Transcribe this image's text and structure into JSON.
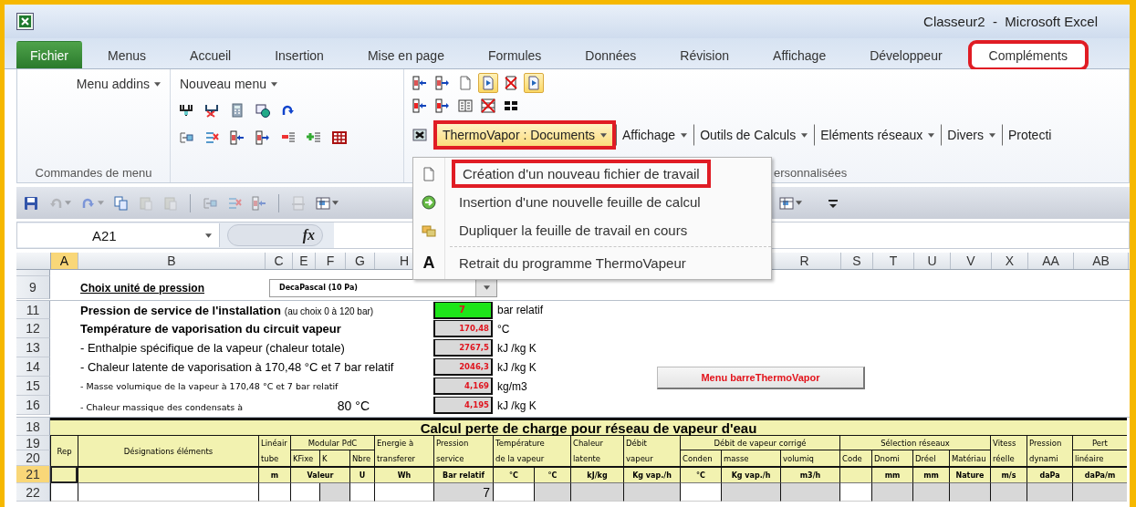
{
  "window": {
    "title": "Classeur2  -  Microsoft Excel"
  },
  "tabs": [
    {
      "label": "Fichier",
      "kind": "file",
      "selected": false,
      "highlighted": false
    },
    {
      "label": "Menus",
      "kind": "tab",
      "selected": false,
      "highlighted": false
    },
    {
      "label": "Accueil",
      "kind": "tab",
      "selected": false,
      "highlighted": false
    },
    {
      "label": "Insertion",
      "kind": "tab",
      "selected": false,
      "highlighted": false
    },
    {
      "label": "Mise en page",
      "kind": "tab",
      "selected": false,
      "highlighted": false
    },
    {
      "label": "Formules",
      "kind": "tab",
      "selected": false,
      "highlighted": false
    },
    {
      "label": "Données",
      "kind": "tab",
      "selected": false,
      "highlighted": false
    },
    {
      "label": "Révision",
      "kind": "tab",
      "selected": false,
      "highlighted": false
    },
    {
      "label": "Affichage",
      "kind": "tab",
      "selected": false,
      "highlighted": false
    },
    {
      "label": "Développeur",
      "kind": "tab",
      "selected": false,
      "highlighted": false
    },
    {
      "label": "Compléments",
      "kind": "tab",
      "selected": true,
      "highlighted": true
    }
  ],
  "ribbon": {
    "menu_group": {
      "menu": "Menu addins",
      "label": "Commandes de menu"
    },
    "new_menu_group": {
      "menu": "Nouveau menu",
      "icon_rows": [
        [
          {
            "kind": "fork",
            "pressed": false
          },
          {
            "kind": "fork-x",
            "pressed": false
          },
          {
            "kind": "calc",
            "pressed": false
          },
          {
            "kind": "globe",
            "pressed": false
          },
          {
            "kind": "redo",
            "pressed": false
          }
        ],
        [
          {
            "kind": "list-arrow",
            "pressed": false
          },
          {
            "kind": "list-x",
            "pressed": false
          },
          {
            "kind": "column-in",
            "pressed": false
          },
          {
            "kind": "column-out",
            "pressed": false
          },
          {
            "kind": "list-minus",
            "pressed": false
          },
          {
            "kind": "list-plus",
            "pressed": false
          },
          {
            "kind": "table",
            "pressed": false
          }
        ]
      ]
    },
    "toolbars_group": {
      "label": "ersonnalisées",
      "icon_rows": [
        [
          {
            "kind": "column-in",
            "pressed": false
          },
          {
            "kind": "column-out",
            "pressed": false
          },
          {
            "kind": "page",
            "pressed": false
          },
          {
            "kind": "doc-blue",
            "pressed": true
          },
          {
            "kind": "page-x",
            "pressed": false
          },
          {
            "kind": "doc-blue",
            "pressed": true
          }
        ],
        [
          {
            "kind": "column-in-red",
            "pressed": false
          },
          {
            "kind": "column-out-red",
            "pressed": false
          },
          {
            "kind": "book",
            "pressed": false
          },
          {
            "kind": "grid-x",
            "pressed": false
          },
          {
            "kind": "tiles",
            "pressed": false
          }
        ]
      ],
      "row_icon": {
        "kind": "image-x",
        "pressed": false
      },
      "menubar": [
        {
          "label": "ThermoVapor : Documents",
          "caret": true,
          "open": true,
          "highlighted": true
        },
        {
          "label": "Affichage",
          "caret": true,
          "open": false,
          "highlighted": false
        },
        {
          "label": "Outils de Calculs",
          "caret": true,
          "open": false,
          "highlighted": false
        },
        {
          "label": "Eléments réseaux",
          "caret": true,
          "open": false,
          "highlighted": false
        },
        {
          "label": "Divers",
          "caret": true,
          "open": false,
          "highlighted": false
        },
        {
          "label": "Protecti",
          "caret": false,
          "open": false,
          "highlighted": false
        }
      ]
    }
  },
  "dropdown": {
    "groups": [
      [
        {
          "kind": "page",
          "label": "Création d'un nouveau fichier de travail",
          "highlighted": true
        },
        {
          "kind": "circle-arrow",
          "label": "Insertion d'une nouvelle feuille de calcul",
          "highlighted": false
        },
        {
          "kind": "folders",
          "label": "Dupliquer la feuille de travail en cours",
          "highlighted": false
        }
      ],
      [
        {
          "kind": "letter",
          "glyph": "A",
          "label": "Retrait du programme ThermoVapeur",
          "highlighted": false
        }
      ]
    ]
  },
  "quick_access": {
    "left": [
      [
        {
          "kind": "save",
          "disabled": false,
          "caret": false
        },
        {
          "kind": "undo",
          "disabled": true,
          "caret": true
        },
        {
          "kind": "redo",
          "disabled": true,
          "caret": true
        },
        {
          "kind": "copy",
          "disabled": false,
          "caret": false
        },
        {
          "kind": "paste",
          "disabled": true,
          "caret": false
        },
        {
          "kind": "paste",
          "disabled": true,
          "caret": false
        }
      ],
      [
        {
          "kind": "list-arrow",
          "disabled": true,
          "caret": false
        },
        {
          "kind": "list-x",
          "disabled": true,
          "caret": false
        },
        {
          "kind": "column-in",
          "disabled": true,
          "caret": false
        }
      ],
      [
        {
          "kind": "page-setup",
          "disabled": true,
          "caret": false
        },
        {
          "kind": "table-grid",
          "disabled": false,
          "caret": true
        }
      ]
    ],
    "right": [
      {
        "kind": "table-grid",
        "disabled": false,
        "caret": true
      },
      {
        "kind": "customize",
        "disabled": false,
        "caret": false
      }
    ]
  },
  "formula_bar": {
    "name_box": "A21",
    "function_label": "fx"
  },
  "sheet": {
    "columns": [
      {
        "label": "A",
        "selected": true
      },
      {
        "label": "B",
        "selected": false
      },
      {
        "label": "C",
        "selected": false
      },
      {
        "label": "E",
        "selected": false
      },
      {
        "label": "F",
        "selected": false
      },
      {
        "label": "G",
        "selected": false
      },
      {
        "label": "H",
        "selected": false
      },
      {
        "label": "R",
        "selected": false
      },
      {
        "label": "S",
        "selected": false
      },
      {
        "label": "T",
        "selected": false
      },
      {
        "label": "U",
        "selected": false
      },
      {
        "label": "V",
        "selected": false
      },
      {
        "label": "X",
        "selected": false
      },
      {
        "label": "AA",
        "selected": false
      },
      {
        "label": "AB",
        "selected": false
      }
    ],
    "unit_choice": {
      "row": "9",
      "label": "Choix unité de pression",
      "value": "DecaPascal (10 Pa)"
    },
    "parameters": [
      {
        "row": "11",
        "kind": "heading",
        "label": "Pression de service de l'installation",
        "note": "(au choix 0 à 120 bar)",
        "value": "7",
        "input": true,
        "unit": "bar relatif"
      },
      {
        "row": "12",
        "kind": "heading",
        "label": "Température de vaporisation du circuit vapeur",
        "value": "170,48",
        "input": false,
        "unit": "°C"
      },
      {
        "row": "13",
        "kind": "normal",
        "label": "- Enthalpie spécifique de la vapeur (chaleur totale)",
        "value": "2767,5",
        "input": false,
        "unit": "kJ /kg K"
      },
      {
        "row": "14",
        "kind": "normal",
        "label": "- Chaleur latente de vaporisation à 170,48 °C et 7 bar relatif",
        "value": "2046,3",
        "input": false,
        "unit": "kJ /kg K"
      },
      {
        "row": "15",
        "kind": "small",
        "label": "- Masse volumique de la vapeur à 170,48 °C et 7 bar relatif",
        "value": "4,169",
        "input": false,
        "unit": "kg/m3"
      },
      {
        "row": "16",
        "kind": "small",
        "label": "- Chaleur massique des condensats à",
        "extra": "80 °C",
        "value": "4,195",
        "input": false,
        "unit": "kJ /kg K"
      }
    ],
    "button": {
      "label": "Menu barreThermoVapor"
    },
    "table": {
      "title_row": "18",
      "title": "Calcul perte de charge pour réseau de vapeur d'eau",
      "header_rows": [
        "19",
        "20"
      ],
      "header": [
        {
          "label": "Rep"
        },
        {
          "label": "Désignations éléments"
        },
        {
          "label": "Linéair",
          "sub": "tube"
        },
        {
          "label": "Modular PdC",
          "children": [
            "KFixe",
            "K",
            "Nbre"
          ]
        },
        {
          "label": "Energie à",
          "sub": "transferer"
        },
        {
          "label": "Pression",
          "sub": "service"
        },
        {
          "label": "Température",
          "sub": "de la vapeur"
        },
        {
          "label": "Chaleur",
          "sub": "latente"
        },
        {
          "label": "Débit",
          "sub": "vapeur"
        },
        {
          "label": "Débit de vapeur corrigé",
          "children": [
            "Conden",
            "masse",
            "volumiq"
          ]
        },
        {
          "label": "Sélection réseaux",
          "children": [
            "Code",
            "Dnomi",
            "Dréel",
            "Matériau"
          ]
        },
        {
          "label": "Vitess",
          "sub": "réelle"
        },
        {
          "label": "Pression",
          "sub": "dynami"
        },
        {
          "label": "Pert",
          "children": [
            "linéaire"
          ]
        }
      ],
      "units_row": {
        "row": "21",
        "selected": true,
        "cells": [
          {
            "selected": true
          },
          {
            "selected": false
          },
          {
            "text": "m",
            "selected": false
          },
          {
            "text": "Valeur",
            "selected": false
          },
          {
            "text": "U",
            "selected": false
          },
          {
            "text": "Wh",
            "selected": false
          },
          {
            "text": "Bar relatif",
            "selected": false
          },
          {
            "text": "°C",
            "selected": false
          },
          {
            "text": "°C",
            "selected": false
          },
          {
            "text": "kJ/kg",
            "selected": false
          },
          {
            "text": "Kg vap./h",
            "selected": false
          },
          {
            "text": "°C",
            "selected": false
          },
          {
            "text": "Kg vap./h",
            "selected": false
          },
          {
            "text": "m3/h",
            "selected": false
          },
          {
            "selected": false
          },
          {
            "text": "mm",
            "selected": false
          },
          {
            "text": "mm",
            "selected": false
          },
          {
            "text": "Nature",
            "selected": false
          },
          {
            "text": "m/s",
            "selected": false
          },
          {
            "text": "daPa",
            "selected": false
          },
          {
            "text": "daPa/m",
            "selected": false
          }
        ]
      },
      "data_row": {
        "row": "22",
        "cells": [
          {
            "shaded": false
          },
          {
            "shaded": false
          },
          {
            "shaded": false
          },
          {
            "shaded": false
          },
          {
            "shaded": true
          },
          {
            "shaded": false
          },
          {
            "shaded": false
          },
          {
            "text": "7",
            "shaded": true
          },
          {
            "shaded": false
          },
          {
            "shaded": true
          },
          {
            "shaded": true
          },
          {
            "shaded": true
          },
          {
            "shaded": false
          },
          {
            "shaded": true
          },
          {
            "shaded": true
          },
          {
            "shaded": false
          },
          {
            "shaded": true
          },
          {
            "shaded": true
          },
          {
            "shaded": true
          },
          {
            "shaded": true
          },
          {
            "shaded": true
          },
          {
            "shaded": true
          }
        ]
      }
    }
  }
}
